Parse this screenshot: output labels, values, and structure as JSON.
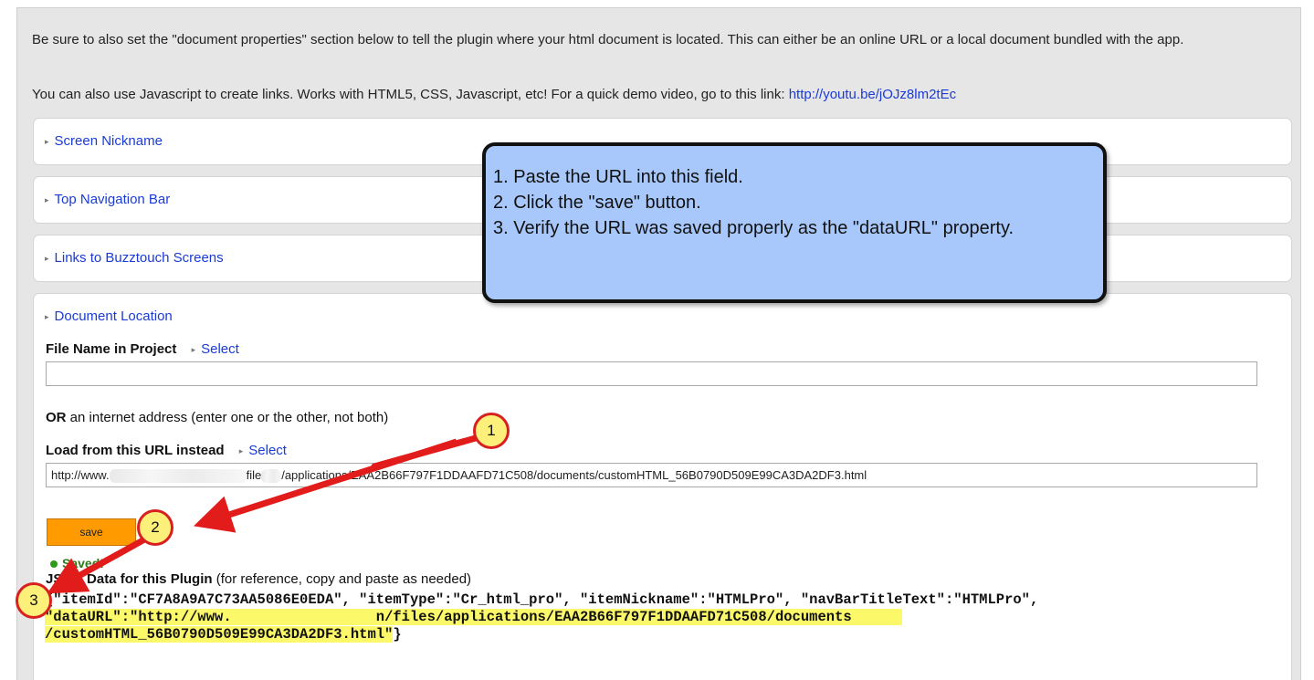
{
  "intro": {
    "line1": "Be sure to also set the \"document properties\" section below to tell the plugin where your html document is located. This can either be an online URL or a local document bundled with the app.",
    "line2_text": "You can also use Javascript to create links. Works with HTML5, CSS, Javascript, etc! For a quick demo video, go to this link: ",
    "line2_link": "http://youtu.be/jOJz8lm2tEc"
  },
  "sections": {
    "screen_nickname": "Screen Nickname",
    "top_nav": "Top Navigation Bar",
    "links": "Links to Buzztouch Screens",
    "doc_location": "Document Location"
  },
  "form": {
    "file_name_label": "File Name in Project",
    "select_label": "Select",
    "file_name_value": "",
    "or_bold": "OR",
    "or_text": " an internet address (enter one or the other, not both)",
    "url_label": "Load from this URL instead",
    "url_value_start": "http://www.",
    "url_value_mid": "file",
    "url_value_end": "/applications/EAA2B66F797F1DDAAFD71C508/documents/customHTML_56B0790D509E99CA3DA2DF3.html",
    "save_label": "save",
    "saved_text": "Saved!",
    "json_label_bold": "JSON Data for this Plugin",
    "json_label_text": " (for reference, copy and paste as needed)",
    "json_line1": "{\"itemId\":\"CF7A8A9A7C73AA5086E0EDA\", \"itemType\":\"Cr_html_pro\", \"itemNickname\":\"HTMLPro\", \"navBarTitleText\":\"HTMLPro\",",
    "json_line2a": "\"dataURL\":\"http://www.",
    "json_line2b": "n/files/applications/EAA2B66F797F1DDAAFD71C508/documents",
    "json_line3": "/customHTML_56B0790D509E99CA3DA2DF3.html\"",
    "json_line3_end": "}"
  },
  "callout": {
    "step1": "1.  Paste the URL into this field.",
    "step2": "2.  Click the \"save\" button.",
    "step3": "3.  Verify the URL was saved properly as the \"dataURL\" property."
  },
  "markers": [
    "1",
    "2",
    "3"
  ],
  "colors": {
    "link": "#1a3bd6",
    "save_button": "#ff9a00",
    "callout": "#a8c8fb",
    "highlight": "#fbf86a",
    "arrow": "#e21b1b"
  }
}
